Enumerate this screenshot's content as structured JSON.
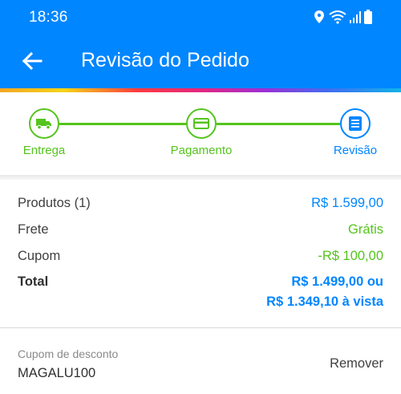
{
  "status_bar": {
    "time": "18:36",
    "icons": [
      "location-icon",
      "wifi-icon",
      "signal-icon",
      "battery-icon"
    ]
  },
  "header": {
    "title": "Revisão do Pedido",
    "back_icon": "arrow-back-icon"
  },
  "stepper": {
    "steps": [
      {
        "label": "Entrega",
        "icon": "truck-icon",
        "state": "done"
      },
      {
        "label": "Pagamento",
        "icon": "card-icon",
        "state": "done"
      },
      {
        "label": "Revisão",
        "icon": "document-icon",
        "state": "active"
      }
    ]
  },
  "summary": {
    "products": {
      "label": "Produtos (1)",
      "value": "R$ 1.599,00"
    },
    "shipping": {
      "label": "Frete",
      "value": "Grátis"
    },
    "coupon": {
      "label": "Cupom",
      "value": "-R$ 100,00"
    },
    "total": {
      "label": "Total",
      "value_line1": "R$ 1.499,00 ou",
      "value_line2": "R$ 1.349,10 à vista"
    }
  },
  "coupon_section": {
    "caption": "Cupom de desconto",
    "code": "MAGALU100",
    "remove_label": "Remover"
  },
  "colors": {
    "primary": "#0086ff",
    "success": "#55c41d",
    "text": "#404040"
  }
}
